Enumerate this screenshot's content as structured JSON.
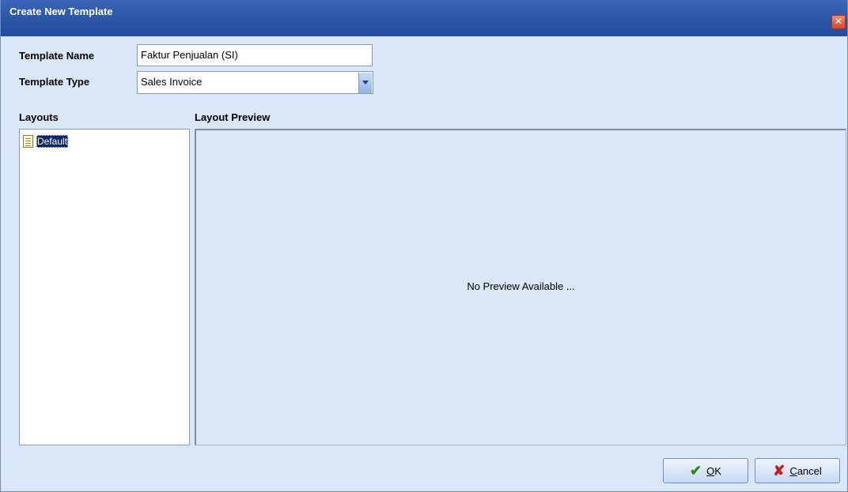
{
  "window": {
    "title": "Create New Template",
    "close_glyph": "✕"
  },
  "form": {
    "template_name_label": "Template Name",
    "template_name_value": "Faktur Penjualan (SI)",
    "template_type_label": "Template Type",
    "template_type_value": "Sales Invoice"
  },
  "layouts": {
    "label": "Layouts",
    "items": [
      {
        "label": "Default",
        "icon": "document-icon",
        "selected": true
      }
    ]
  },
  "preview": {
    "label": "Layout Preview",
    "empty_text": "No Preview Available ..."
  },
  "buttons": {
    "ok_label_underlined": "O",
    "ok_label_rest": "K",
    "cancel_label_underlined": "C",
    "cancel_label_rest": "ancel",
    "ok_icon": "checkmark-icon",
    "cancel_icon": "x-icon"
  },
  "colors": {
    "title_bar": "#2f58a8",
    "window_bg": "#d9e7f8",
    "selection": "#0a246a"
  }
}
